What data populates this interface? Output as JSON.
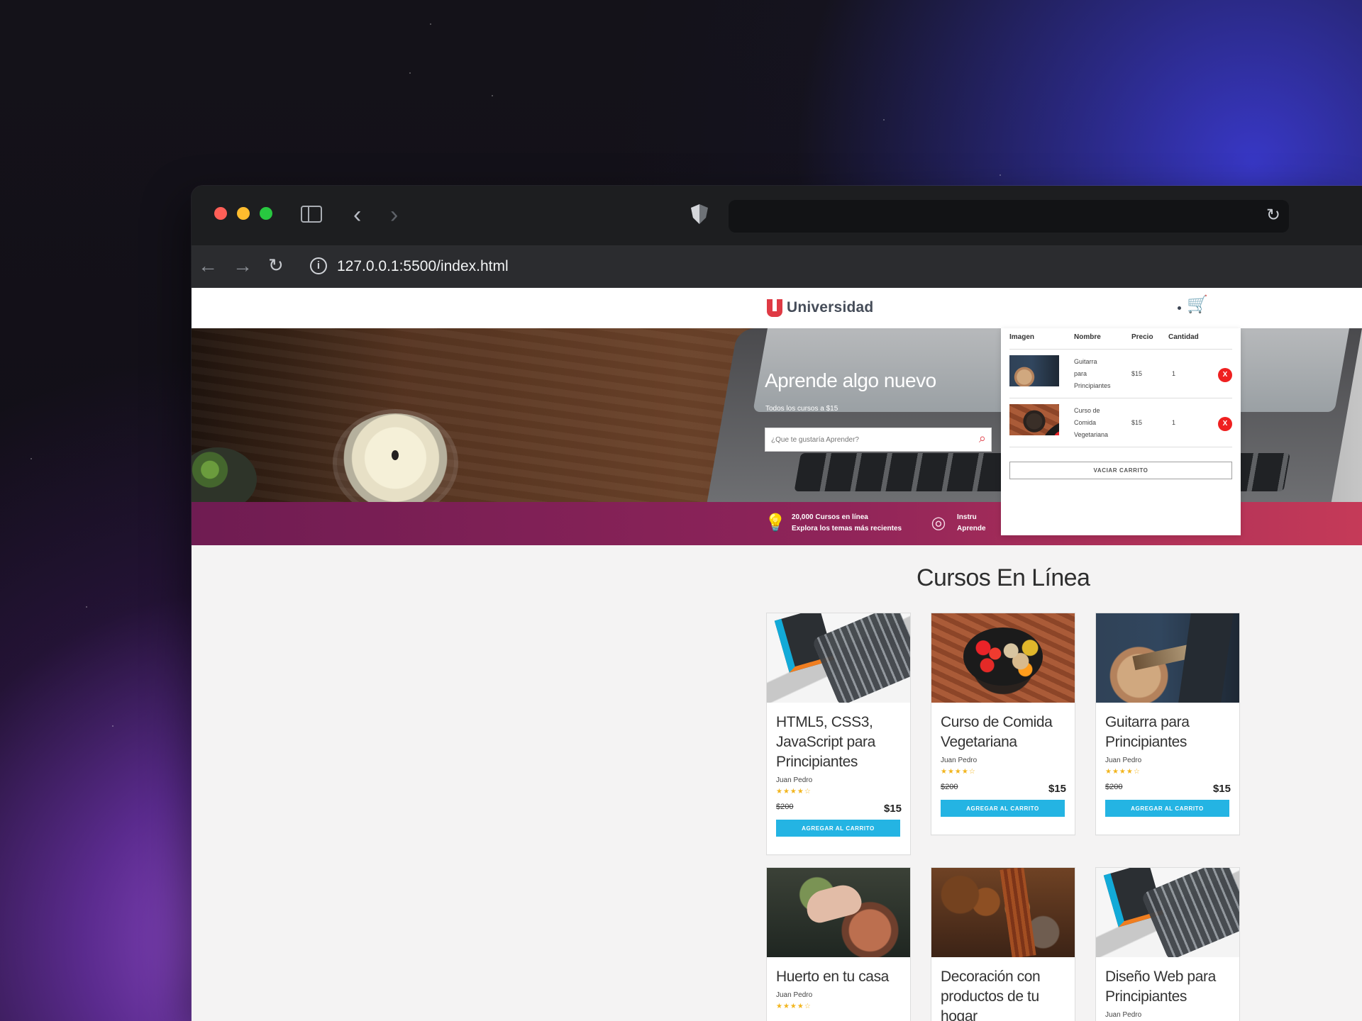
{
  "browser": {
    "url": "127.0.0.1:5500/index.html"
  },
  "icons": {
    "sidebar": "sidebar-icon",
    "back": "arrow-left-icon",
    "forward": "arrow-right-icon",
    "reload": "reload-icon",
    "shield": "shield-icon",
    "info": "info-icon",
    "cart": "shopping-cart-icon",
    "search": "search-icon",
    "lightbulb": "lightbulb-icon",
    "target": "target-icon",
    "remove": "x-icon"
  },
  "colors": {
    "brand_red": "#df3a44",
    "add_to_cart_blue": "#24b4e3",
    "promo_start": "#6f1c52",
    "promo_end": "#c53a58",
    "remove_red": "#ef2020"
  },
  "site": {
    "logo_text": "Universidad",
    "hero": {
      "title": "Aprende algo nuevo",
      "subtitle": "Todos los cursos a $15",
      "search_placeholder": "¿Que te gustaría Aprender?"
    },
    "promo": [
      {
        "line1": "20,000 Cursos en línea",
        "line2": "Explora los temas más recientes"
      },
      {
        "line1": "Instru",
        "line2": "Aprende"
      }
    ],
    "section_title": "Cursos En Línea",
    "cart": {
      "headers": {
        "image": "Imagen",
        "name": "Nombre",
        "price": "Precio",
        "quantity": "Cantidad"
      },
      "items": [
        {
          "name_lines": [
            "Guitarra",
            "para",
            "Principiantes"
          ],
          "price": "$15",
          "quantity": "1",
          "remove_label": "X",
          "image_kind": "guitar"
        },
        {
          "name_lines": [
            "Curso de",
            "Comida",
            "Vegetariana"
          ],
          "price": "$15",
          "quantity": "1",
          "remove_label": "X",
          "image_kind": "vegetables"
        }
      ],
      "clear_label": "VACIAR CARRITO"
    },
    "courses": [
      {
        "title": "HTML5, CSS3, JavaScript para Principiantes",
        "author": "Juan Pedro",
        "rating": "★★★★☆",
        "old_price": "$200",
        "new_price": "$15",
        "button": "AGREGAR AL CARRITO",
        "image_kind": "laptop"
      },
      {
        "title": "Curso de Comida Vegetariana",
        "author": "Juan Pedro",
        "rating": "★★★★☆",
        "old_price": "$200",
        "new_price": "$15",
        "button": "AGREGAR AL CARRITO",
        "image_kind": "vegetables"
      },
      {
        "title": "Guitarra para Principiantes",
        "author": "Juan Pedro",
        "rating": "★★★★☆",
        "old_price": "$200",
        "new_price": "$15",
        "button": "AGREGAR AL CARRITO",
        "image_kind": "guitar"
      },
      {
        "title": "Huerto en tu casa",
        "author": "Juan Pedro",
        "rating": "★★★★☆",
        "image_kind": "garden"
      },
      {
        "title": "Decoración con productos de tu hogar",
        "author": "",
        "rating": "",
        "image_kind": "spices"
      },
      {
        "title": "Diseño Web para Principiantes",
        "author": "Juan Pedro",
        "rating": "",
        "image_kind": "laptop"
      }
    ]
  }
}
